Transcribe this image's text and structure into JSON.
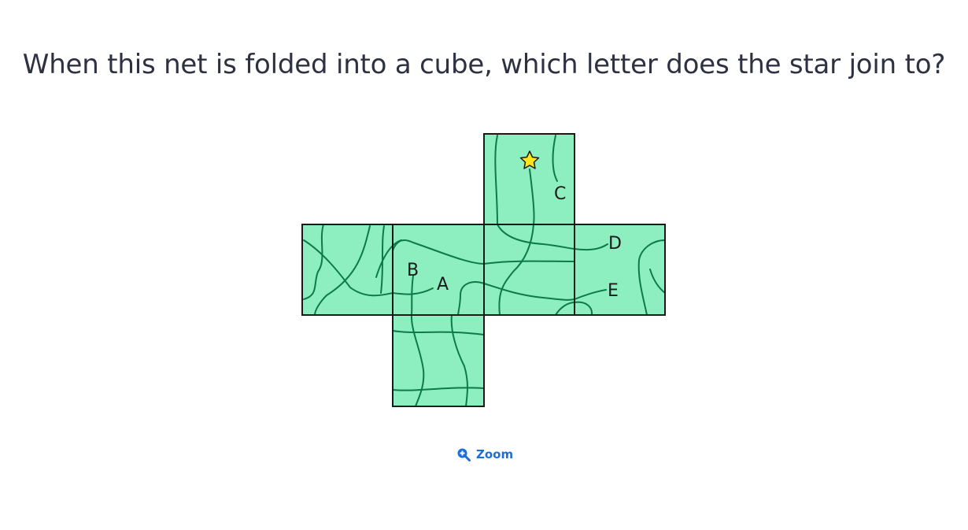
{
  "question": "When this net is folded into a cube, which letter does the star join to?",
  "net": {
    "face_color": "#8deebf",
    "line_color": "#0d7a4a",
    "border_color": "#1a1a1a",
    "star_color": "#ffe619",
    "letters": [
      "A",
      "B",
      "C",
      "D",
      "E"
    ]
  },
  "zoom": {
    "label": "Zoom",
    "icon": "zoom-in-icon",
    "color": "#1d6fd6"
  }
}
